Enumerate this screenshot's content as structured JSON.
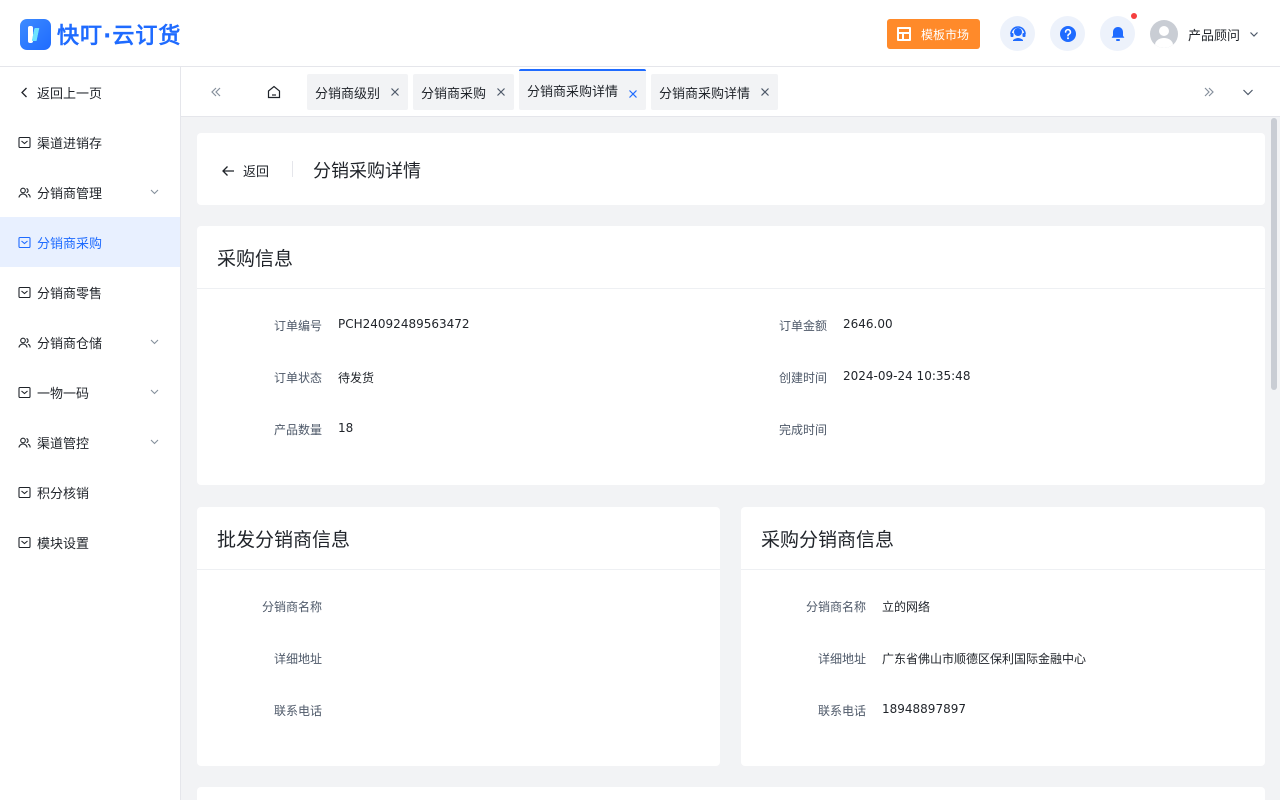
{
  "header": {
    "logo_text": "快叮·云订货",
    "template_market": "模板市场",
    "user_name": "产品顾问",
    "icons": [
      "support-icon",
      "help-icon",
      "bell-icon"
    ]
  },
  "sidebar": {
    "items": [
      {
        "label": "返回上一页",
        "icon": "chevron-left-icon"
      },
      {
        "label": "渠道进销存",
        "icon": "box-icon"
      },
      {
        "label": "分销商管理",
        "icon": "users-icon",
        "expandable": true
      },
      {
        "label": "分销商采购",
        "icon": "box-icon",
        "active": true
      },
      {
        "label": "分销商零售",
        "icon": "box-icon"
      },
      {
        "label": "分销商仓储",
        "icon": "users-icon",
        "expandable": true
      },
      {
        "label": "一物一码",
        "icon": "box-icon",
        "expandable": true
      },
      {
        "label": "渠道管控",
        "icon": "users-icon",
        "expandable": true
      },
      {
        "label": "积分核销",
        "icon": "box-icon"
      },
      {
        "label": "模块设置",
        "icon": "box-icon"
      }
    ]
  },
  "tabs": [
    {
      "label": "分销商级别"
    },
    {
      "label": "分销商采购"
    },
    {
      "label": "分销商采购详情",
      "active": true
    },
    {
      "label": "分销商采购详情"
    }
  ],
  "page": {
    "back_label": "返回",
    "title": "分销采购详情"
  },
  "purchase_info": {
    "title": "采购信息",
    "order_no_label": "订单编号",
    "order_no": "PCH24092489563472",
    "amount_label": "订单金额",
    "amount": "2646.00",
    "status_label": "订单状态",
    "status": "待发货",
    "created_label": "创建时间",
    "created": "2024-09-24 10:35:48",
    "qty_label": "产品数量",
    "qty": "18",
    "finished_label": "完成时间",
    "finished": ""
  },
  "wholesale_info": {
    "title": "批发分销商信息",
    "name_label": "分销商名称",
    "name": "",
    "address_label": "详细地址",
    "address": "",
    "phone_label": "联系电话",
    "phone": ""
  },
  "buyer_info": {
    "title": "采购分销商信息",
    "name_label": "分销商名称",
    "name": "立的网络",
    "address_label": "详细地址",
    "address": "广东省佛山市顺德区保利国际金融中心",
    "phone_label": "联系电话",
    "phone": "18948897897"
  },
  "colors": {
    "brand": "#1f6bff",
    "accent_orange": "#ff8a2a",
    "active_bg": "#e8f0ff",
    "badge_red": "#f53f3f"
  }
}
